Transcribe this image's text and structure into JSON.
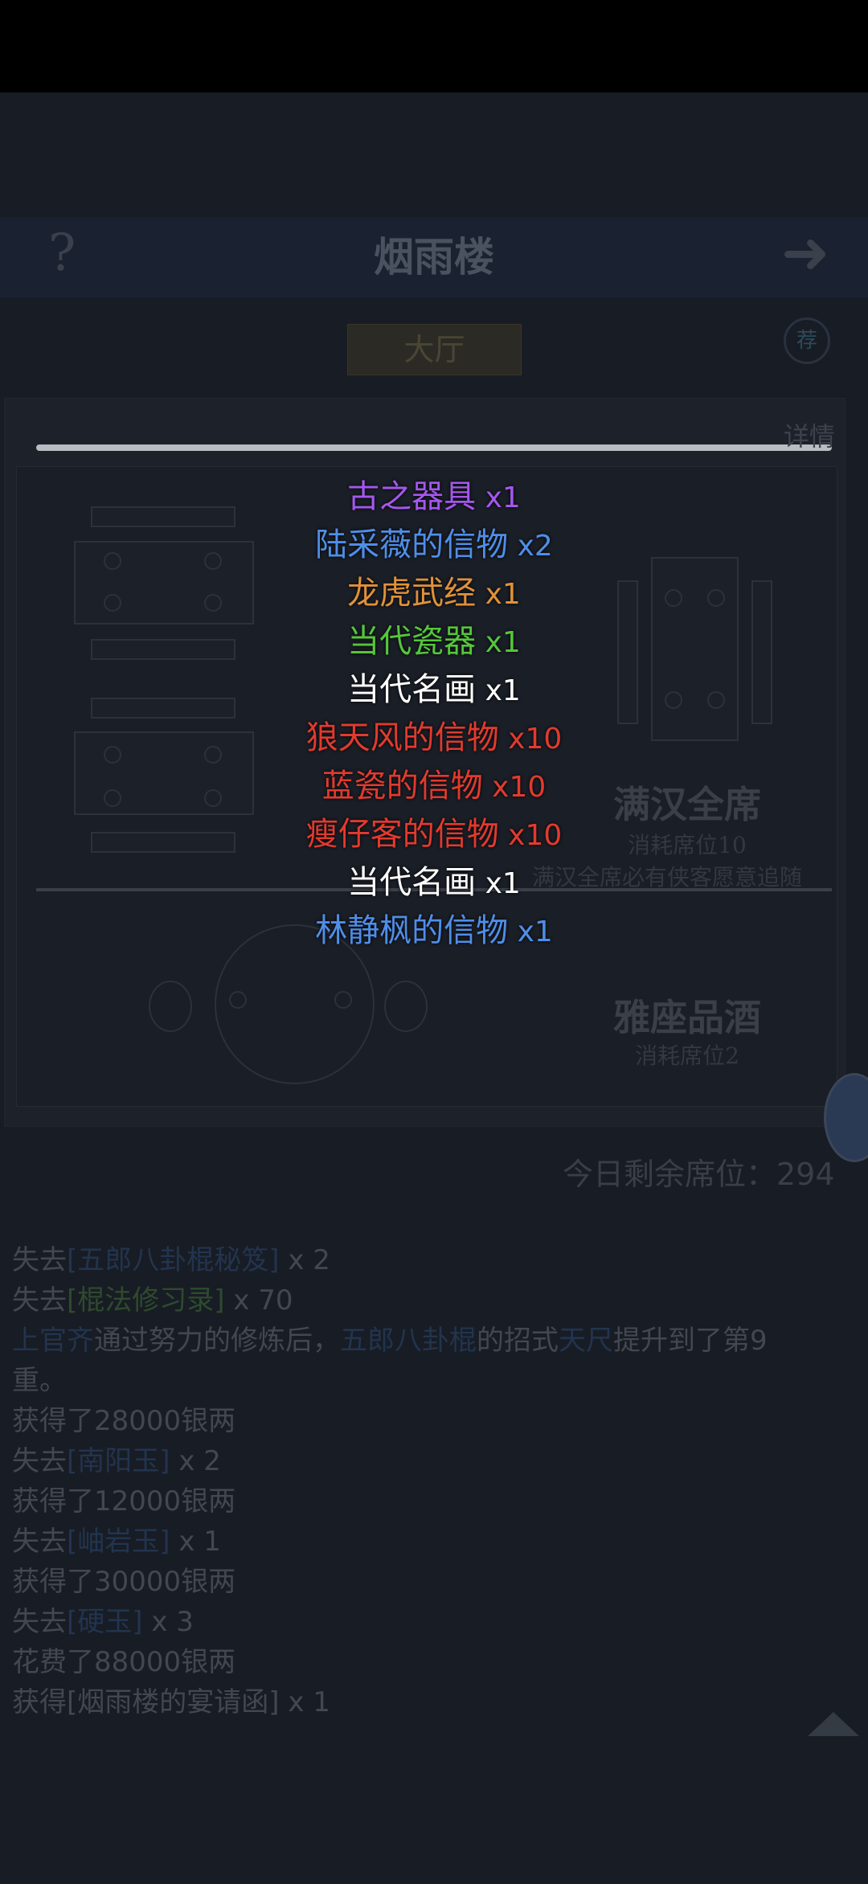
{
  "header": {
    "title": "烟雨楼",
    "help_label": "?",
    "next_label": "➜"
  },
  "tab": {
    "label": "大厅"
  },
  "side": {
    "round_icon_label": "荐",
    "detail_label": "详情"
  },
  "feasts": [
    {
      "name": "满汉全席",
      "cost": "消耗席位10",
      "desc": "满汉全席必有侠客愿意追随"
    },
    {
      "name": "雅座品酒",
      "cost": "消耗席位2"
    }
  ],
  "seats_remaining": "今日剩余席位：294",
  "log": {
    "lines": [
      {
        "parts": [
          {
            "t": "失去",
            "c": "plain"
          },
          {
            "t": "[五郎八卦棍秘笈]",
            "c": "blue"
          },
          {
            "t": " x 2",
            "c": "plain"
          }
        ]
      },
      {
        "parts": [
          {
            "t": "失去",
            "c": "plain"
          },
          {
            "t": "[棍法修习录]",
            "c": "green"
          },
          {
            "t": " x 70",
            "c": "plain"
          }
        ]
      },
      {
        "parts": [
          {
            "t": "上官齐",
            "c": "blue"
          },
          {
            "t": "通过努力的修炼后，",
            "c": "plain"
          },
          {
            "t": "五郎八卦棍",
            "c": "blue"
          },
          {
            "t": "的招式",
            "c": "plain"
          },
          {
            "t": "天尺",
            "c": "blue"
          },
          {
            "t": "提升到了第9",
            "c": "plain"
          }
        ]
      },
      {
        "parts": [
          {
            "t": "重。",
            "c": "plain"
          }
        ]
      },
      {
        "parts": [
          {
            "t": "获得了28000银两",
            "c": "plain"
          }
        ]
      },
      {
        "parts": [
          {
            "t": "失去",
            "c": "plain"
          },
          {
            "t": "[南阳玉]",
            "c": "blue"
          },
          {
            "t": " x 2",
            "c": "plain"
          }
        ]
      },
      {
        "parts": [
          {
            "t": "获得了12000银两",
            "c": "plain"
          }
        ]
      },
      {
        "parts": [
          {
            "t": "失去",
            "c": "plain"
          },
          {
            "t": "[岫岩玉]",
            "c": "blue"
          },
          {
            "t": " x 1",
            "c": "plain"
          }
        ]
      },
      {
        "parts": [
          {
            "t": "获得了30000银两",
            "c": "plain"
          }
        ]
      },
      {
        "parts": [
          {
            "t": "失去",
            "c": "plain"
          },
          {
            "t": "[硬玉]",
            "c": "blue"
          },
          {
            "t": " x 3",
            "c": "plain"
          }
        ]
      },
      {
        "parts": [
          {
            "t": "花费了88000银两",
            "c": "plain"
          }
        ]
      },
      {
        "parts": [
          {
            "t": "获得",
            "c": "plain"
          },
          {
            "t": "[烟雨楼的宴请函]",
            "c": "plain"
          },
          {
            "t": " x 1",
            "c": "plain"
          }
        ]
      }
    ]
  },
  "popup": {
    "items": [
      {
        "name": "古之器具",
        "qty": "x1",
        "color": "#a457ee"
      },
      {
        "name": "陆采薇的信物",
        "qty": "x2",
        "color": "#4f8ee8"
      },
      {
        "name": "龙虎武经",
        "qty": "x1",
        "color": "#e0913a"
      },
      {
        "name": "当代瓷器",
        "qty": "x1",
        "color": "#55c63c"
      },
      {
        "name": "当代名画",
        "qty": "x1",
        "color": "#ffffff"
      },
      {
        "name": "狼天风的信物",
        "qty": "x10",
        "color": "#e23a2e"
      },
      {
        "name": "蓝瓷的信物",
        "qty": "x10",
        "color": "#e23a2e"
      },
      {
        "name": "瘦仔客的信物",
        "qty": "x10",
        "color": "#e23a2e"
      },
      {
        "name": "当代名画",
        "qty": "x1",
        "color": "#ffffff"
      },
      {
        "name": "林静枫的信物",
        "qty": "x1",
        "color": "#4f8ee8"
      }
    ]
  }
}
